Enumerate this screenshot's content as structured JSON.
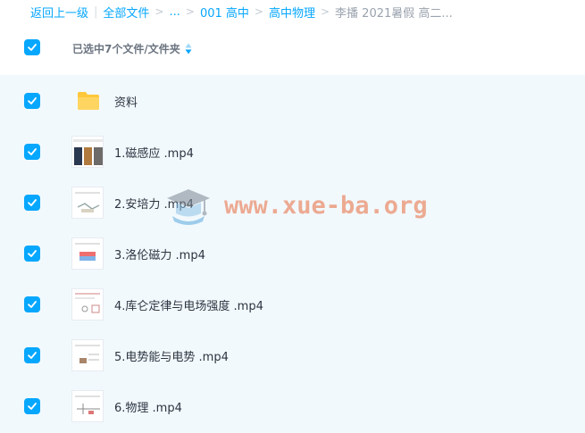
{
  "breadcrumb": {
    "back": "返回上一级",
    "all_files": "全部文件",
    "ellipsis": "...",
    "level1": "001 高中",
    "level2": "高中物理",
    "current": "李播 2021暑假 高二..."
  },
  "header": {
    "selection_label": "已选中7个文件/文件夹"
  },
  "files": [
    {
      "name": "资料",
      "type": "folder",
      "checked": true
    },
    {
      "name": "1.磁感应 .mp4",
      "type": "video",
      "checked": true
    },
    {
      "name": "2.安培力 .mp4",
      "type": "video",
      "checked": true
    },
    {
      "name": "3.洛伦磁力 .mp4",
      "type": "video",
      "checked": true
    },
    {
      "name": "4.库仑定律与电场强度 .mp4",
      "type": "video",
      "checked": true
    },
    {
      "name": "5.电势能与电势 .mp4",
      "type": "video",
      "checked": true
    },
    {
      "name": "6.物理 .mp4",
      "type": "video",
      "checked": true
    }
  ],
  "watermark": {
    "text": "www.xue-ba.org",
    "icon": "graduation-cap-icon"
  },
  "colors": {
    "accent": "#06a7ff",
    "list_bg": "#f2f9fd",
    "folder": "#ffc73b",
    "watermark": "#e86a3c"
  }
}
